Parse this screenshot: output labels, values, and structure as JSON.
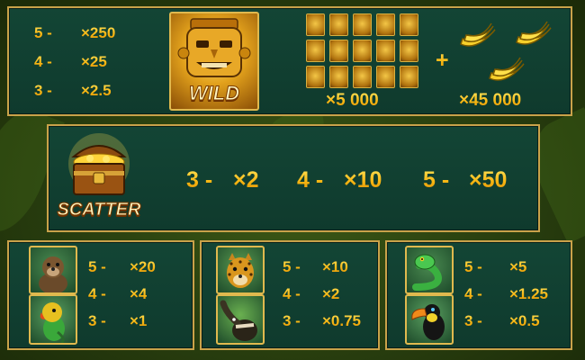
{
  "wild": {
    "label": "WILD",
    "pays": [
      {
        "count": "5 -",
        "mult": "×250"
      },
      {
        "count": "4 -",
        "mult": "×25"
      },
      {
        "count": "3 -",
        "mult": "×2.5"
      }
    ],
    "grid_payout": "×5 000",
    "plus": "+",
    "bonus_payout": "×45 000"
  },
  "scatter": {
    "label": "SCATTER",
    "pays": [
      {
        "count": "3 -",
        "mult": "×2"
      },
      {
        "count": "4 -",
        "mult": "×10"
      },
      {
        "count": "5 -",
        "mult": "×50"
      }
    ]
  },
  "panels": [
    {
      "symbols": [
        "otter-icon",
        "parrot-icon"
      ],
      "pays": [
        {
          "count": "5 -",
          "mult": "×20"
        },
        {
          "count": "4 -",
          "mult": "×4"
        },
        {
          "count": "3 -",
          "mult": "×1"
        }
      ]
    },
    {
      "symbols": [
        "jaguar-icon",
        "anteater-icon"
      ],
      "pays": [
        {
          "count": "5 -",
          "mult": "×10"
        },
        {
          "count": "4 -",
          "mult": "×2"
        },
        {
          "count": "3 -",
          "mult": "×0.75"
        }
      ]
    },
    {
      "symbols": [
        "snake-icon",
        "toucan-icon"
      ],
      "pays": [
        {
          "count": "5 -",
          "mult": "×5"
        },
        {
          "count": "4 -",
          "mult": "×1.25"
        },
        {
          "count": "3 -",
          "mult": "×0.5"
        }
      ]
    }
  ],
  "colors": {
    "panel": "#0f3a2d",
    "border": "#c9a24a",
    "gold": "#f5c21c",
    "jungle": "#2b4210"
  }
}
